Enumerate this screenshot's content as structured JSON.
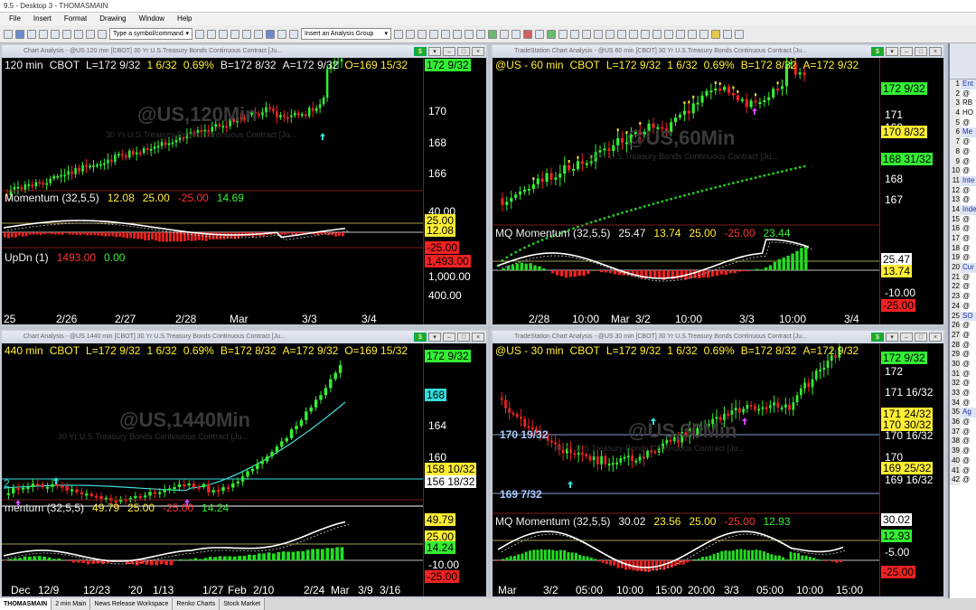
{
  "titlebar": {
    "title": "9.5 - Desktop 3 - THOMASMAIN"
  },
  "menu": [
    "File",
    "Insert",
    "Format",
    "Drawing",
    "Window",
    "Help"
  ],
  "toolbar": {
    "symbol_placeholder": "Type a symbol/command",
    "analysis_group": "Insert an Analysis Group"
  },
  "window_title_prefix": "TradeStation Chart Analysis",
  "windows": {
    "tl": {
      "title": "Chart Analysis - @US 120 min [CBOT] 30 Yr U.S.Treasury Bonds Continuous Contract [Ju...",
      "header": {
        "tf": "120 min",
        "ex": "CBOT",
        "last": "L=172 9/32",
        "chg": "1 6/32",
        "pct": "0.69%",
        "bid": "B=172 8/32",
        "ask": "A=172 9/32",
        "open": "O=169 15/32"
      },
      "watermark": "@US,120Min",
      "watermark_sub": "30 Yr U.S.Treasury Bonds Continuous Contract [Ju...",
      "indicator": {
        "name": "Momentum (32,5,5)",
        "v1": "12.08",
        "v2": "25.00",
        "v3": "-25.00",
        "v4": "14.69"
      },
      "indicator2": {
        "name": "UpDn (1)",
        "v1": "1493.00",
        "v2": "0.00"
      },
      "price_labels": [
        "170",
        "168",
        "166",
        "40.00",
        "1,000.00",
        "400.00"
      ],
      "tags": [
        {
          "t": "172 9/32",
          "c": "#33ee33"
        },
        {
          "t": "25.00",
          "c": "#ffee33"
        },
        {
          "t": "12.08",
          "c": "#ffee33"
        },
        {
          "t": "-25.00",
          "c": "#ff2222"
        },
        {
          "t": "1,493.00",
          "c": "#ff2222"
        }
      ],
      "x_labels": [
        "25",
        "2/26",
        "2/27",
        "2/28",
        "Mar",
        "3/3",
        "3/4"
      ]
    },
    "tr": {
      "title": "TradeStation Chart Analysis - @US 60 min [CBOT] 30 Yr U.S.Treasury Bonds Continuous Contract [Ju...",
      "header": {
        "sym": "@US - 60 min",
        "ex": "CBOT",
        "last": "L=172 9/32",
        "chg": "1 6/32",
        "pct": "0.69%",
        "bid": "B=172 8/32",
        "ask": "A=172 9/32"
      },
      "watermark": "@US,60Min",
      "watermark_sub": "30 Yr U.S.Treasury Bonds Continuous Contract [Ju...",
      "indicator": {
        "name": "MQ Momentum (32,5,5)",
        "v1": "25.47",
        "v2": "13.74",
        "v3": "25.00",
        "v4": "-25.00",
        "v5": "23.44"
      },
      "price_labels": [
        "171",
        "169",
        "168",
        "167",
        "-10.00"
      ],
      "tags": [
        {
          "t": "172 9/32",
          "c": "#33ee33"
        },
        {
          "t": "170 8/32",
          "c": "#ffee33"
        },
        {
          "t": "168 31/32",
          "c": "#33ee33"
        },
        {
          "t": "25.47",
          "c": "#ffffff"
        },
        {
          "t": "13.74",
          "c": "#ffee33"
        },
        {
          "t": "-25.00",
          "c": "#ff2222"
        }
      ],
      "x_labels": [
        "2/28",
        "10:00",
        "Mar",
        "3/2",
        "10:00",
        "3/3",
        "10:00",
        "3/4"
      ]
    },
    "bl": {
      "title": "Chart Analysis - @US 1440 min [CBOT] 30 Yr U.S.Treasury Bonds Continuous Contract [Ju...",
      "header": {
        "tf": "440 min",
        "ex": "CBOT",
        "last": "L=172 9/32",
        "chg": "1 6/32",
        "pct": "0.69%",
        "bid": "B=172 8/32",
        "ask": "A=172 9/32",
        "open": "O=169 15/32"
      },
      "watermark": "@US,1440Min",
      "watermark_sub": "30 Yr U.S.Treasury Bonds Continuous Contract [Ju...",
      "indicator": {
        "name": "mentum (32,5,5)",
        "v1": "49.79",
        "v2": "25.00",
        "v3": "-25.00",
        "v4": "14.24"
      },
      "price_labels": [
        "164",
        "160",
        "-10.00",
        "2"
      ],
      "tags": [
        {
          "t": "172 9/32",
          "c": "#33ee33"
        },
        {
          "t": "168",
          "c": "#33dddd"
        },
        {
          "t": "158 10/32",
          "c": "#ffee33"
        },
        {
          "t": "156 18/32",
          "c": "#ffffff"
        },
        {
          "t": "49.79",
          "c": "#ffee33"
        },
        {
          "t": "25.00",
          "c": "#ffee33"
        },
        {
          "t": "14.24",
          "c": "#33ee33"
        },
        {
          "t": "-25.00",
          "c": "#ff2222"
        }
      ],
      "x_labels": [
        "Dec",
        "12/9",
        "12/23",
        "'20",
        "1/13",
        "1/27",
        "Feb",
        "2/10",
        "2/24",
        "Mar",
        "3/9",
        "3/16"
      ]
    },
    "br": {
      "title": "TradeStation Chart Analysis - @US 30 min [CBOT] 30 Yr U.S.Treasury Bonds Continuous Contract [Ju...",
      "header": {
        "sym": "@US - 30 min",
        "ex": "CBOT",
        "last": "L=172 9/32",
        "chg": "1 6/32",
        "pct": "0.69%",
        "bid": "B=172 8/32",
        "ask": "A=172 9/32"
      },
      "watermark": "@US,30Min",
      "watermark_sub": "30 Yr U.S.Treasury Bonds Continuous Contract [Ju...",
      "left_labels": [
        "170 19/32",
        "169 7/32"
      ],
      "indicator": {
        "name": "MQ Momentum (32,5,5)",
        "v1": "30.02",
        "v2": "23.56",
        "v3": "25.00",
        "v4": "-25.00",
        "v5": "12.93"
      },
      "price_labels": [
        "172",
        "171 16/32",
        "170 16/32",
        "170",
        "169 16/32",
        "-5.00"
      ],
      "tags": [
        {
          "t": "172 9/32",
          "c": "#33ee33"
        },
        {
          "t": "171 24/32",
          "c": "#ffee33"
        },
        {
          "t": "170 30/32",
          "c": "#ffee33"
        },
        {
          "t": "169 25/32",
          "c": "#ffee33"
        },
        {
          "t": "30.02",
          "c": "#ffffff"
        },
        {
          "t": "12.93",
          "c": "#33ee33"
        },
        {
          "t": "-25.00",
          "c": "#ff2222"
        }
      ],
      "x_labels": [
        "Mar",
        "3/2",
        "05:00",
        "10:00",
        "15:00",
        "20:00",
        "3/3",
        "05:00",
        "10:00",
        "15:00"
      ]
    }
  },
  "sidebar": {
    "rows": [
      {
        "n": "1",
        "t": "Ent",
        "c": "#2233aa"
      },
      {
        "n": "2",
        "t": "@",
        "c": "#000"
      },
      {
        "n": "3",
        "t": "RB",
        "c": "#000"
      },
      {
        "n": "4",
        "t": "HO",
        "c": "#000"
      },
      {
        "n": "5",
        "t": "@",
        "c": "#000"
      },
      {
        "n": "6",
        "t": "Me",
        "c": "#2233aa"
      },
      {
        "n": "7",
        "t": "@",
        "c": "#000"
      },
      {
        "n": "8",
        "t": "@",
        "c": "#000"
      },
      {
        "n": "9",
        "t": "@",
        "c": "#000"
      },
      {
        "n": "10",
        "t": "@",
        "c": "#000"
      },
      {
        "n": "11",
        "t": "Inte",
        "c": "#2233aa"
      },
      {
        "n": "12",
        "t": "@",
        "c": "#000"
      },
      {
        "n": "13",
        "t": "@",
        "c": "#000"
      },
      {
        "n": "14",
        "t": "Inde",
        "c": "#2233aa"
      },
      {
        "n": "15",
        "t": "@",
        "c": "#000"
      },
      {
        "n": "16",
        "t": "@",
        "c": "#000"
      },
      {
        "n": "17",
        "t": "@",
        "c": "#000"
      },
      {
        "n": "18",
        "t": "@",
        "c": "#000"
      },
      {
        "n": "19",
        "t": "@",
        "c": "#000"
      },
      {
        "n": "20",
        "t": "Cur",
        "c": "#2233aa"
      },
      {
        "n": "21",
        "t": "@",
        "c": "#000"
      },
      {
        "n": "22",
        "t": "@",
        "c": "#000"
      },
      {
        "n": "23",
        "t": "@",
        "c": "#000"
      },
      {
        "n": "24",
        "t": "@",
        "c": "#000"
      },
      {
        "n": "25",
        "t": "SO",
        "c": "#2233aa"
      },
      {
        "n": "26",
        "t": "@",
        "c": "#000"
      },
      {
        "n": "27",
        "t": "@",
        "c": "#000"
      },
      {
        "n": "28",
        "t": "@",
        "c": "#000"
      },
      {
        "n": "29",
        "t": "@",
        "c": "#000"
      },
      {
        "n": "30",
        "t": "@",
        "c": "#000"
      },
      {
        "n": "31",
        "t": "@",
        "c": "#000"
      },
      {
        "n": "32",
        "t": "@",
        "c": "#000"
      },
      {
        "n": "33",
        "t": "@",
        "c": "#000"
      },
      {
        "n": "34",
        "t": "@",
        "c": "#000"
      },
      {
        "n": "35",
        "t": "Ag",
        "c": "#2233aa"
      },
      {
        "n": "36",
        "t": "@",
        "c": "#000"
      },
      {
        "n": "37",
        "t": "@",
        "c": "#000"
      },
      {
        "n": "38",
        "t": "@",
        "c": "#000"
      },
      {
        "n": "39",
        "t": "@",
        "c": "#000"
      },
      {
        "n": "40",
        "t": "@",
        "c": "#000"
      },
      {
        "n": "41",
        "t": "@",
        "c": "#000"
      },
      {
        "n": "42",
        "t": "@",
        "c": "#000"
      }
    ]
  },
  "status_tabs": [
    "THOMASMAIN",
    "2 min Main",
    "News Release Workspace",
    "Renko Charts",
    "Stock Market"
  ],
  "colors": {
    "up": "#33ee33",
    "down": "#ee2222",
    "momentum": "#ffffff",
    "dotted": "#33cc33",
    "accent_tag_green": "#33ee33"
  }
}
